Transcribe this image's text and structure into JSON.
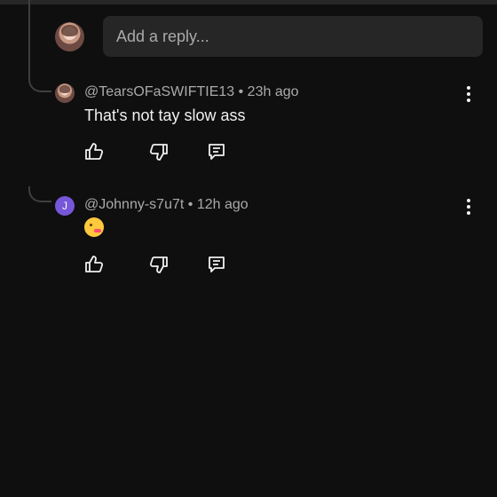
{
  "reply_input": {
    "placeholder": "Add a reply..."
  },
  "comments": [
    {
      "handle": "@TearsOFaSWIFTIE13",
      "time": "23h ago",
      "text": "That's not tay slow ass",
      "avatar_letter": ""
    },
    {
      "handle": "@Johnny-s7u7t",
      "time": "12h ago",
      "text": "😘",
      "avatar_letter": "J"
    }
  ],
  "colors": {
    "background": "#0f0f0f",
    "reply_box": "#262626",
    "muted_text": "#aaaaaa",
    "avatar_purple": "#7656d9"
  },
  "icons": [
    "thumbs-up-icon",
    "thumbs-down-icon",
    "reply-icon",
    "more-vert-icon"
  ]
}
